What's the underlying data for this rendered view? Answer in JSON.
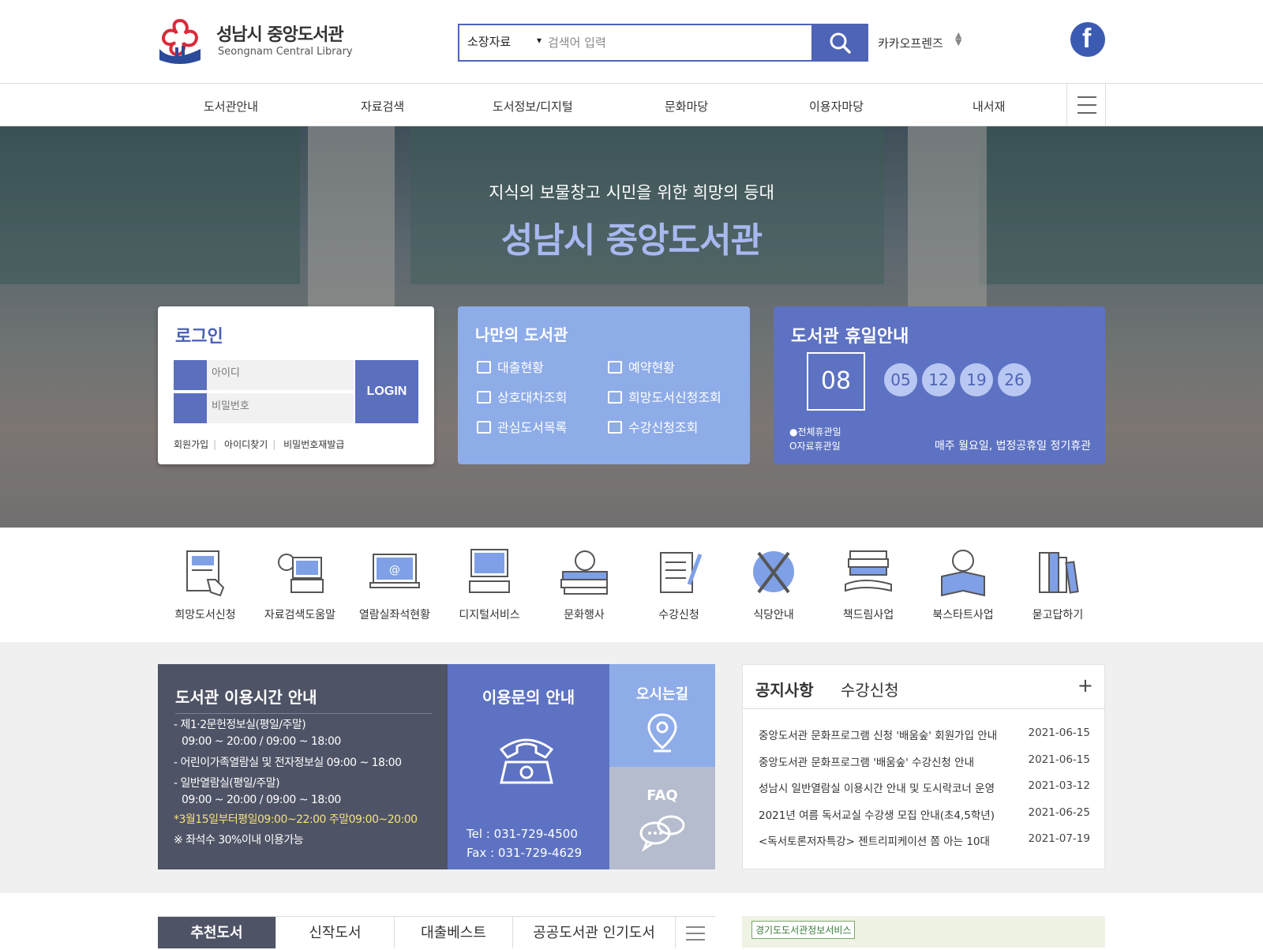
{
  "header": {
    "logo_title": "성남시 중앙도서관",
    "logo_subtitle": "Seongnam Central Library",
    "search_select": "소장자료",
    "search_placeholder": "검색어 입력",
    "kakao_label": "카카오프렌즈"
  },
  "nav": {
    "items": [
      {
        "label": "도서관안내"
      },
      {
        "label": "자료검색"
      },
      {
        "label": "도서정보/디지털"
      },
      {
        "label": "문화마당"
      },
      {
        "label": "이용자마당"
      },
      {
        "label": "내서재"
      }
    ]
  },
  "hero": {
    "kicker": "지식의 보물창고 시민을 위한 희망의 등대",
    "title": "성남시 중앙도서관"
  },
  "login": {
    "title": "로그인",
    "id_placeholder": "아이디",
    "pw_placeholder": "비밀번호",
    "button": "LOGIN",
    "links": [
      "회원가입",
      "아이디찾기",
      "비밀번호재발급"
    ]
  },
  "mylib": {
    "title": "나만의 도서관",
    "items": [
      {
        "label": "대출현황"
      },
      {
        "label": "예약현황"
      },
      {
        "label": "상호대차조회"
      },
      {
        "label": "희망도서신청조회"
      },
      {
        "label": "관심도서목록"
      },
      {
        "label": "수강신청조회"
      }
    ]
  },
  "holiday": {
    "title": "도서관 휴일안내",
    "main_day": "08",
    "days": [
      "05",
      "12",
      "19",
      "26"
    ],
    "legend_full": "●전체휴관일",
    "legend_partial": "O자료휴관일",
    "note": "매주 월요일, 법정공휴일 정기휴관"
  },
  "quick": [
    {
      "label": "희망도서신청",
      "icon": "book-request-icon"
    },
    {
      "label": "자료검색도움말",
      "icon": "search-help-icon"
    },
    {
      "label": "열람실좌석현황",
      "icon": "seat-status-icon"
    },
    {
      "label": "디지털서비스",
      "icon": "digital-service-icon"
    },
    {
      "label": "문화행사",
      "icon": "culture-event-icon"
    },
    {
      "label": "수강신청",
      "icon": "class-register-icon"
    },
    {
      "label": "식당안내",
      "icon": "restaurant-icon"
    },
    {
      "label": "책드림사업",
      "icon": "book-dream-icon"
    },
    {
      "label": "북스타트사업",
      "icon": "bookstart-icon"
    },
    {
      "label": "묻고답하기",
      "icon": "qna-icon"
    }
  ],
  "hours": {
    "title": "도서관 이용시간 안내",
    "lines": [
      "- 제1·2문헌정보실(평일/주말)",
      "09:00 ~ 20:00 / 09:00 ~ 18:00",
      "- 어린이가족열람실 및 전자정보실 09:00 ~ 18:00",
      "- 일반열람실(평일/주말)",
      "09:00 ~ 20:00 / 09:00 ~ 18:00",
      "*3월15일부터평일09:00~22:00 주말09:00~20:00",
      "※ 좌석수 30%이내 이용가능"
    ]
  },
  "contact": {
    "title": "이용문의 안내",
    "tel": "Tel : 031-729-4500",
    "fax": "Fax : 031-729-4629"
  },
  "directions_label": "오시는길",
  "faq_label": "FAQ",
  "notice": {
    "tabs": [
      "공지사항",
      "수강신청"
    ],
    "plus": "+",
    "rows": [
      {
        "title": "중앙도서관 문화프로그램 신청 '배움숲' 회원가입 안내",
        "date": "2021-06-15"
      },
      {
        "title": "중앙도서관 문화프로그램 '배움숲' 수강신청 안내",
        "date": "2021-06-15"
      },
      {
        "title": "성남시 일반열람실 이용시간 안내 및 도시락코너 운영",
        "date": "2021-03-12"
      },
      {
        "title": "2021년 여름 독서교실 수강생 모집 안내(초4,5학년)",
        "date": "2021-06-25"
      },
      {
        "title": "<독서토론저자특강> 젠트리피케이션 쫌 아는 10대",
        "date": "2021-07-19"
      }
    ]
  },
  "booktabs": [
    "추천도서",
    "신작도서",
    "대출베스트",
    "공공도서관 인기도서"
  ],
  "banner_label": "경기도도서관정보서비스"
}
